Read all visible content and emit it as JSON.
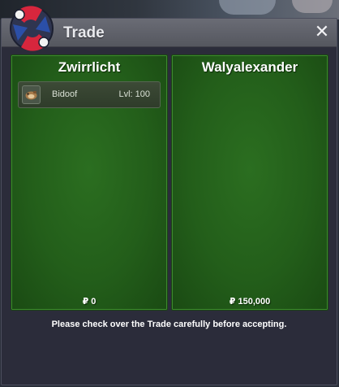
{
  "window": {
    "title": "Trade",
    "close_symbol": "✕",
    "logo_icon": "pokeball-trade-icon"
  },
  "left_panel": {
    "player_name": "Zwirrlicht",
    "pokemon": [
      {
        "name": "Bidoof",
        "level_text": "Lvl: 100",
        "icon": "bidoof-icon"
      }
    ],
    "money": "₽ 0"
  },
  "right_panel": {
    "player_name": "Walyalexander",
    "pokemon": [],
    "money": "₽ 150,000"
  },
  "footer": {
    "message": "Please check over the Trade carefully before accepting."
  },
  "colors": {
    "panel_green": "#235e1a",
    "window_bg": "#2b2c3a",
    "titlebar": "#5f6169",
    "pokeball_red": "#d7263d",
    "pokeball_blue": "#2b4fa8"
  }
}
